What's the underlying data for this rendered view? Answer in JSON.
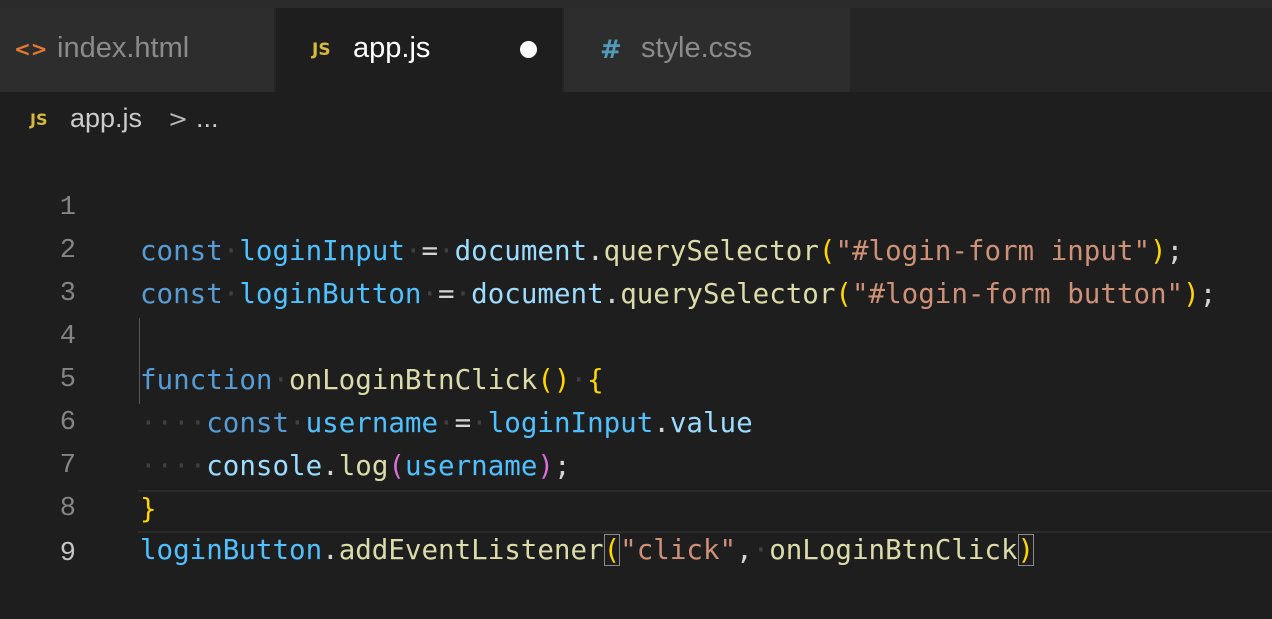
{
  "tabs": [
    {
      "label": "index.html",
      "icon": "<>",
      "icon_name": "html-file-icon",
      "icon_color": "#e37933",
      "active": false
    },
    {
      "label": "app.js",
      "icon": "JS",
      "icon_name": "javascript-file-icon",
      "icon_color": "#d7ba3d",
      "active": true,
      "modified": true
    },
    {
      "label": "style.css",
      "icon": "#",
      "icon_name": "css-file-icon",
      "icon_color": "#519aba",
      "active": false
    }
  ],
  "breadcrumb": {
    "icon": "JS",
    "file": "app.js",
    "separator": ">",
    "more": "..."
  },
  "editor": {
    "current_line": 9,
    "lines": [
      {
        "num": "1"
      },
      {
        "num": "2"
      },
      {
        "num": "3"
      },
      {
        "num": "4"
      },
      {
        "num": "5"
      },
      {
        "num": "6"
      },
      {
        "num": "7"
      },
      {
        "num": "8"
      },
      {
        "num": "9"
      }
    ],
    "tokens": {
      "const": "const",
      "function": "function",
      "loginInput": "loginInput",
      "loginButton": "loginButton",
      "document": "document",
      "querySelector": "querySelector",
      "str_input": "\"#login-form input\"",
      "str_button": "\"#login-form button\"",
      "onLoginBtnClick": "onLoginBtnClick",
      "username": "username",
      "value": "value",
      "console": "console",
      "log": "log",
      "addEventListener": "addEventListener",
      "str_click": "\"click\""
    }
  },
  "colors": {
    "background": "#1e1e1e",
    "tab_inactive": "#2d2d2d",
    "keyword": "#569cd6",
    "variable": "#4fc1ff",
    "function": "#dcdcaa",
    "string": "#ce9178",
    "bracket_1": "#ffd700",
    "bracket_2": "#da70d6"
  }
}
